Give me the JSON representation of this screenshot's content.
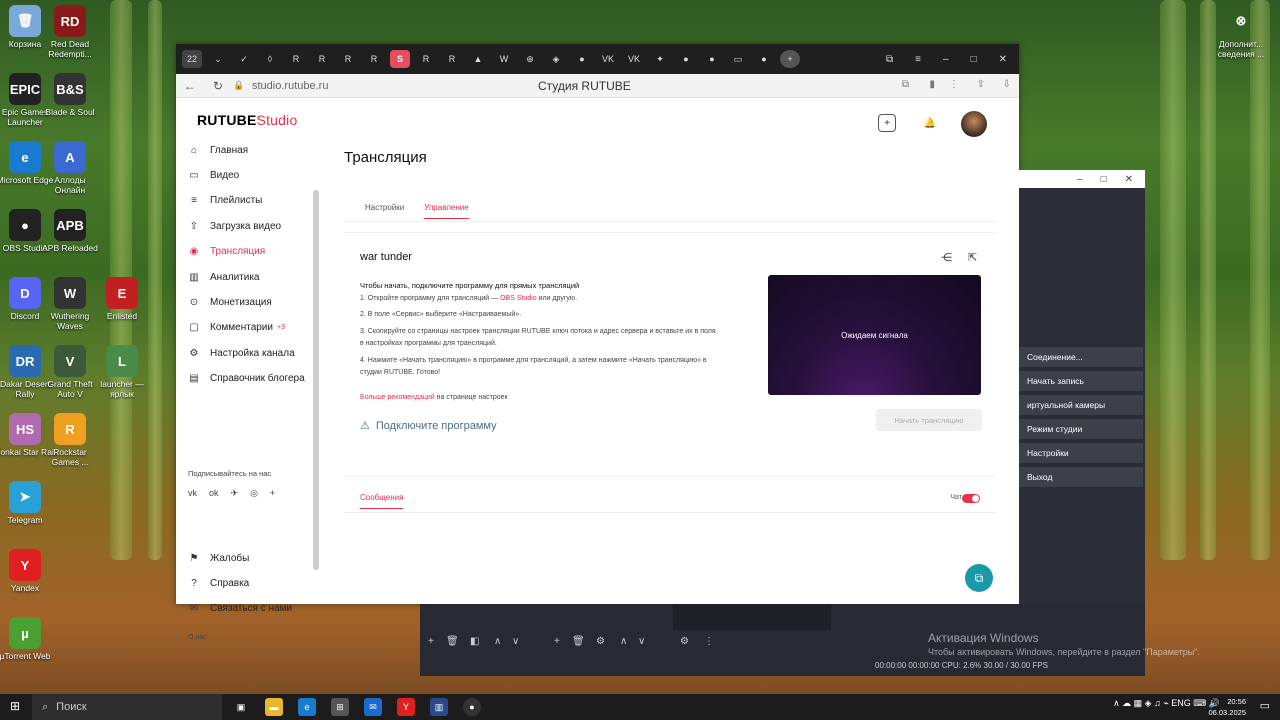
{
  "desktop": {
    "icons": [
      {
        "label": "Корзина",
        "color": "#7aa8d8",
        "glyph": "🗑"
      },
      {
        "label": "Red Dead Redempti...",
        "color": "#8a1a1a",
        "glyph": "RD"
      },
      {
        "label": "Epic Games Launcher",
        "color": "#222",
        "glyph": "EPIC"
      },
      {
        "label": "Blade & Soul",
        "color": "#333",
        "glyph": "B&S"
      },
      {
        "label": "Microsoft Edge",
        "color": "#1a7ad0",
        "glyph": "e"
      },
      {
        "label": "Аллоды Онлайн",
        "color": "#3a6ad0",
        "glyph": "A"
      },
      {
        "label": "OBS Studio",
        "color": "#222",
        "glyph": "●"
      },
      {
        "label": "APB Reloaded",
        "color": "#222",
        "glyph": "APB"
      },
      {
        "label": "Discord",
        "color": "#5865f2",
        "glyph": "D"
      },
      {
        "label": "Wuthering Waves",
        "color": "#333",
        "glyph": "W"
      },
      {
        "label": "Dakar Desert Rally",
        "color": "#2a6ab0",
        "glyph": "DR"
      },
      {
        "label": "Grand Theft Auto V",
        "color": "#3a5a3a",
        "glyph": "V"
      },
      {
        "label": "Honkai Star Rail",
        "color": "#b06ab0",
        "glyph": "HS"
      },
      {
        "label": "Rockstar Games ...",
        "color": "#f0a020",
        "glyph": "R"
      },
      {
        "label": "Telegram",
        "color": "#2aa0d8",
        "glyph": "➤"
      },
      {
        "label": "Yandex",
        "color": "#e02020",
        "glyph": "Y"
      },
      {
        "label": "µTorrent Web",
        "color": "#4aa030",
        "glyph": "µ"
      },
      {
        "label": "Enlisted",
        "color": "#c02020",
        "glyph": "E"
      },
      {
        "label": "launcher — ярлык",
        "color": "#4a8a4a",
        "glyph": "L"
      },
      {
        "label": "Дополнит... сведения ...",
        "color": "transparent",
        "glyph": "⊗"
      }
    ]
  },
  "browser": {
    "tab_count": "22",
    "url": "studio.rutube.ru",
    "title": "Студия RUTUBE"
  },
  "app": {
    "logo_main": "RUTUBE",
    "logo_sub": "Studio",
    "sidebar": [
      {
        "label": "Главная",
        "icon": "⌂"
      },
      {
        "label": "Видео",
        "icon": "▭"
      },
      {
        "label": "Плейлисты",
        "icon": "≡"
      },
      {
        "label": "Загрузка видео",
        "icon": "⇧"
      },
      {
        "label": "Трансляция",
        "icon": "◉",
        "active": true
      },
      {
        "label": "Аналитика",
        "icon": "▥"
      },
      {
        "label": "Монетизация",
        "icon": "⊙"
      },
      {
        "label": "Комментарии",
        "icon": "▢",
        "badge": "+3"
      },
      {
        "label": "Настройка канала",
        "icon": "⚙"
      },
      {
        "label": "Справочник блогера",
        "icon": "▤"
      }
    ],
    "subscribe": "Подписывайтесь на нас",
    "bottom_items": [
      {
        "label": "Жалобы",
        "icon": "⚑"
      },
      {
        "label": "Справка",
        "icon": "?"
      },
      {
        "label": "Связаться с нами",
        "icon": "✉"
      }
    ],
    "about": "О нас",
    "page_title": "Трансляция",
    "tabs": [
      "Настройки",
      "Управление"
    ],
    "stream": {
      "name": "war tunder",
      "heading": "Чтобы начать, подключите программу для прямых трансляций",
      "step1_a": "1. Откройте программу для трансляций — ",
      "step1_link": "OBS Studio",
      "step1_b": " или другую.",
      "step2": "2. В поле «Сервис» выберите «Настраиваемый».",
      "step3": "3. Скопируйте со страницы настроек трансляции RUTUBE ключ потока и адрес сервера и вставьте их в поля в настройках программы для трансляций.",
      "step4": "4. Нажмите «Начать трансляцию» в программе для трансляций, а затем нажмите «Начать трансляцию» в студии RUTUBE. Готово!",
      "more_link": "Больше рекомендаций",
      "more_rest": " на странице настроек",
      "preview": "Ожидаем сигнала",
      "connect": "Подключите программу",
      "start": "Начать трансляцию"
    },
    "messages": {
      "tab": "Сообщения",
      "chat": "Чат"
    }
  },
  "obs": {
    "buttons": [
      "Соединение...",
      "Начать запись",
      "иртуальной камеры",
      "Режим студии",
      "Настройки",
      "Выход"
    ],
    "status": "00:00:00    00:00:00    CPU: 2.6%    30.00 / 30.00 FPS"
  },
  "activation": {
    "title": "Активация Windows",
    "sub": "Чтобы активировать Windows, перейдите в раздел \"Параметры\"."
  },
  "taskbar": {
    "search": "Поиск",
    "lang": "ENG",
    "time": "20:56",
    "date": "06.03.2025"
  }
}
